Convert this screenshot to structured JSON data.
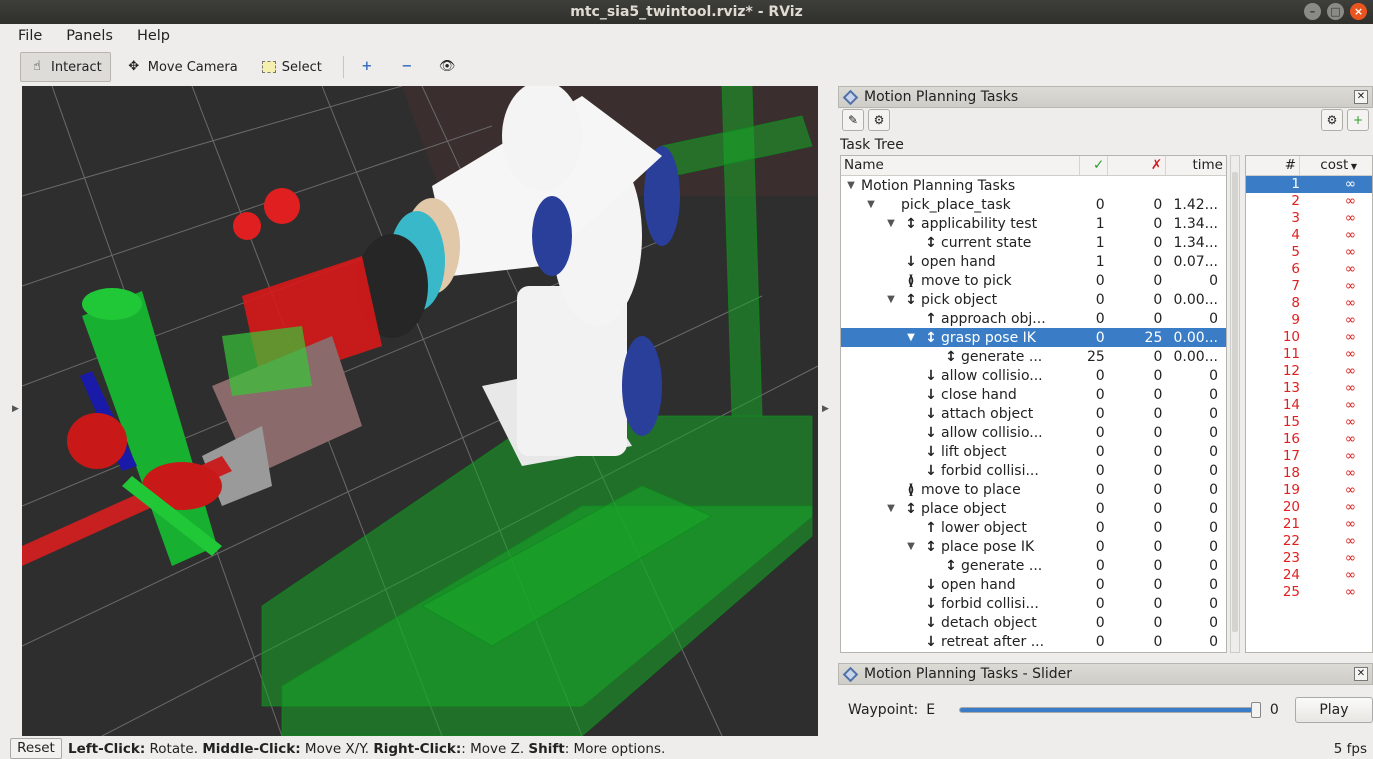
{
  "window": {
    "title": "mtc_sia5_twintool.rviz* - RViz"
  },
  "menu": [
    "File",
    "Panels",
    "Help"
  ],
  "toolbar": {
    "interact": "Interact",
    "move_camera": "Move Camera",
    "select": "Select"
  },
  "panel": {
    "title": "Motion Planning Tasks",
    "tree_label": "Task Tree",
    "columns": {
      "name": "Name",
      "ok": "✓",
      "fail": "✗",
      "time": "time",
      "num": "#",
      "cost": "cost"
    }
  },
  "tree_rows": [
    {
      "indent": 0,
      "arrow": "▼",
      "sym": "",
      "name": "Motion Planning Tasks",
      "ok": "",
      "fail": "",
      "time": ""
    },
    {
      "indent": 1,
      "arrow": "▼",
      "sym": "",
      "name": "pick_place_task",
      "ok": "0",
      "fail": "0",
      "time": "1.42..."
    },
    {
      "indent": 2,
      "arrow": "▼",
      "sym": "↕",
      "name": "applicability test",
      "ok": "1",
      "fail": "0",
      "time": "1.34..."
    },
    {
      "indent": 3,
      "arrow": "",
      "sym": "↕",
      "name": "current state",
      "ok": "1",
      "fail": "0",
      "time": "1.34..."
    },
    {
      "indent": 2,
      "arrow": "",
      "sym": "↓",
      "name": "open hand",
      "ok": "1",
      "fail": "0",
      "time": "0.07..."
    },
    {
      "indent": 2,
      "arrow": "",
      "sym": "≬",
      "name": "move to pick",
      "ok": "0",
      "fail": "0",
      "time": "0"
    },
    {
      "indent": 2,
      "arrow": "▼",
      "sym": "↕",
      "name": "pick object",
      "ok": "0",
      "fail": "0",
      "time": "0.00..."
    },
    {
      "indent": 3,
      "arrow": "",
      "sym": "↑",
      "name": "approach obj...",
      "ok": "0",
      "fail": "0",
      "time": "0"
    },
    {
      "indent": 3,
      "arrow": "▼",
      "sym": "↕",
      "name": "grasp pose IK",
      "ok": "0",
      "fail": "25",
      "time": "0.00...",
      "sel": true
    },
    {
      "indent": 4,
      "arrow": "",
      "sym": "↕",
      "name": "generate ...",
      "ok": "25",
      "fail": "0",
      "time": "0.00..."
    },
    {
      "indent": 3,
      "arrow": "",
      "sym": "↓",
      "name": "allow collisio...",
      "ok": "0",
      "fail": "0",
      "time": "0"
    },
    {
      "indent": 3,
      "arrow": "",
      "sym": "↓",
      "name": "close hand",
      "ok": "0",
      "fail": "0",
      "time": "0"
    },
    {
      "indent": 3,
      "arrow": "",
      "sym": "↓",
      "name": "attach object",
      "ok": "0",
      "fail": "0",
      "time": "0"
    },
    {
      "indent": 3,
      "arrow": "",
      "sym": "↓",
      "name": "allow collisio...",
      "ok": "0",
      "fail": "0",
      "time": "0"
    },
    {
      "indent": 3,
      "arrow": "",
      "sym": "↓",
      "name": "lift object",
      "ok": "0",
      "fail": "0",
      "time": "0"
    },
    {
      "indent": 3,
      "arrow": "",
      "sym": "↓",
      "name": "forbid collisi...",
      "ok": "0",
      "fail": "0",
      "time": "0"
    },
    {
      "indent": 2,
      "arrow": "",
      "sym": "≬",
      "name": "move to place",
      "ok": "0",
      "fail": "0",
      "time": "0"
    },
    {
      "indent": 2,
      "arrow": "▼",
      "sym": "↕",
      "name": "place object",
      "ok": "0",
      "fail": "0",
      "time": "0"
    },
    {
      "indent": 3,
      "arrow": "",
      "sym": "↑",
      "name": "lower object",
      "ok": "0",
      "fail": "0",
      "time": "0"
    },
    {
      "indent": 3,
      "arrow": "▼",
      "sym": "↕",
      "name": "place pose IK",
      "ok": "0",
      "fail": "0",
      "time": "0"
    },
    {
      "indent": 4,
      "arrow": "",
      "sym": "↕",
      "name": "generate ...",
      "ok": "0",
      "fail": "0",
      "time": "0"
    },
    {
      "indent": 3,
      "arrow": "",
      "sym": "↓",
      "name": "open hand",
      "ok": "0",
      "fail": "0",
      "time": "0"
    },
    {
      "indent": 3,
      "arrow": "",
      "sym": "↓",
      "name": "forbid collisi...",
      "ok": "0",
      "fail": "0",
      "time": "0"
    },
    {
      "indent": 3,
      "arrow": "",
      "sym": "↓",
      "name": "detach object",
      "ok": "0",
      "fail": "0",
      "time": "0"
    },
    {
      "indent": 3,
      "arrow": "",
      "sym": "↓",
      "name": "retreat after ...",
      "ok": "0",
      "fail": "0",
      "time": "0"
    }
  ],
  "solutions": [
    {
      "n": "1",
      "c": "∞"
    },
    {
      "n": "2",
      "c": "∞"
    },
    {
      "n": "3",
      "c": "∞"
    },
    {
      "n": "4",
      "c": "∞"
    },
    {
      "n": "5",
      "c": "∞"
    },
    {
      "n": "6",
      "c": "∞"
    },
    {
      "n": "7",
      "c": "∞"
    },
    {
      "n": "8",
      "c": "∞"
    },
    {
      "n": "9",
      "c": "∞"
    },
    {
      "n": "10",
      "c": "∞"
    },
    {
      "n": "11",
      "c": "∞"
    },
    {
      "n": "12",
      "c": "∞"
    },
    {
      "n": "13",
      "c": "∞"
    },
    {
      "n": "14",
      "c": "∞"
    },
    {
      "n": "15",
      "c": "∞"
    },
    {
      "n": "16",
      "c": "∞"
    },
    {
      "n": "17",
      "c": "∞"
    },
    {
      "n": "18",
      "c": "∞"
    },
    {
      "n": "19",
      "c": "∞"
    },
    {
      "n": "20",
      "c": "∞"
    },
    {
      "n": "21",
      "c": "∞"
    },
    {
      "n": "22",
      "c": "∞"
    },
    {
      "n": "23",
      "c": "∞"
    },
    {
      "n": "24",
      "c": "∞"
    },
    {
      "n": "25",
      "c": "∞"
    }
  ],
  "slider": {
    "title": "Motion Planning Tasks - Slider",
    "waypoint_label": "Waypoint:",
    "waypoint_value": "E",
    "end_value": "0",
    "play": "Play",
    "position": 1.0
  },
  "status": {
    "reset": "Reset",
    "help_left_b": "Left-Click:",
    "help_left": " Rotate. ",
    "help_mid_b": "Middle-Click:",
    "help_mid": " Move X/Y. ",
    "help_right_b": "Right-Click:",
    "help_right": ": Move Z. ",
    "help_shift_b": "Shift",
    "help_shift": ": More options.",
    "fps": "5 fps"
  },
  "colors": {
    "selection": "#3a7dc6",
    "ok": "#2a9d2a",
    "fail": "#d02020",
    "cost": "#e02020"
  }
}
